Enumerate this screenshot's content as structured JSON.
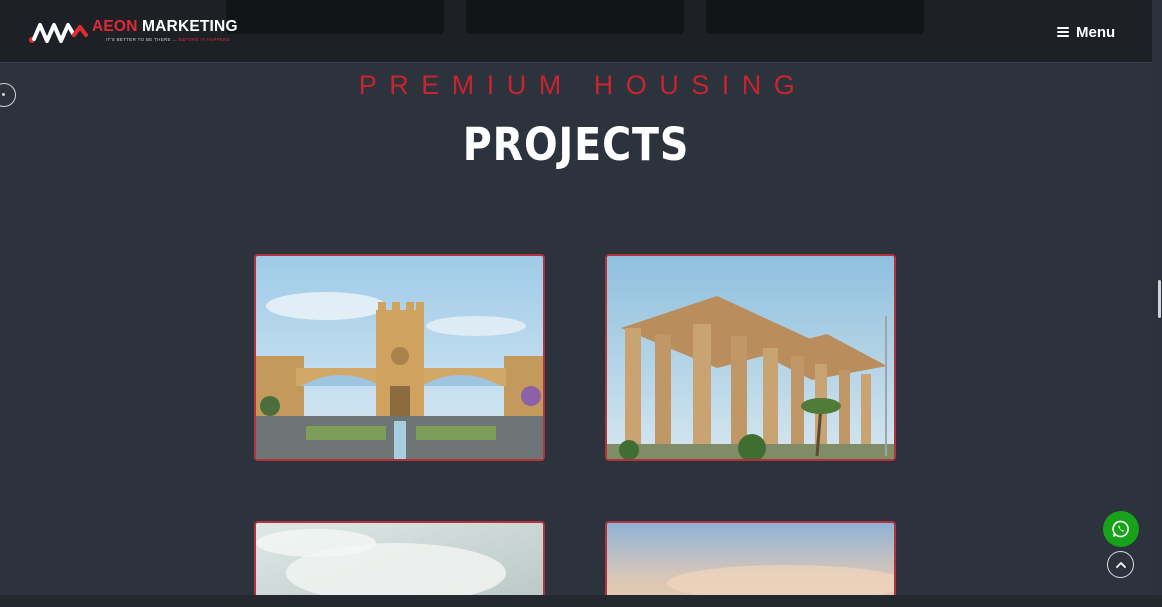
{
  "header": {
    "brand_primary": "AEON",
    "brand_secondary": "MARKETING",
    "tagline_left": "IT'S BETTER TO BE THERE ...",
    "tagline_right": "BEFORE IT HAPPENS",
    "menu_label": "Menu",
    "menu_icon": "hamburger-icon"
  },
  "section": {
    "eyebrow": "PREMIUM HOUSING",
    "title": "PROJECTS"
  },
  "projects": [
    {
      "image": "fort-gate-entrance-image"
    },
    {
      "image": "stone-colonnade-image"
    },
    {
      "image": "cloudy-sky-image"
    },
    {
      "image": "sunset-sky-image"
    }
  ],
  "floating": {
    "whatsapp_icon": "whatsapp-icon",
    "scroll_top_icon": "chevron-up-icon"
  },
  "colors": {
    "accent": "#c8242e",
    "background": "#2c333c",
    "header": "#1d2126",
    "whatsapp": "#17a21a"
  }
}
